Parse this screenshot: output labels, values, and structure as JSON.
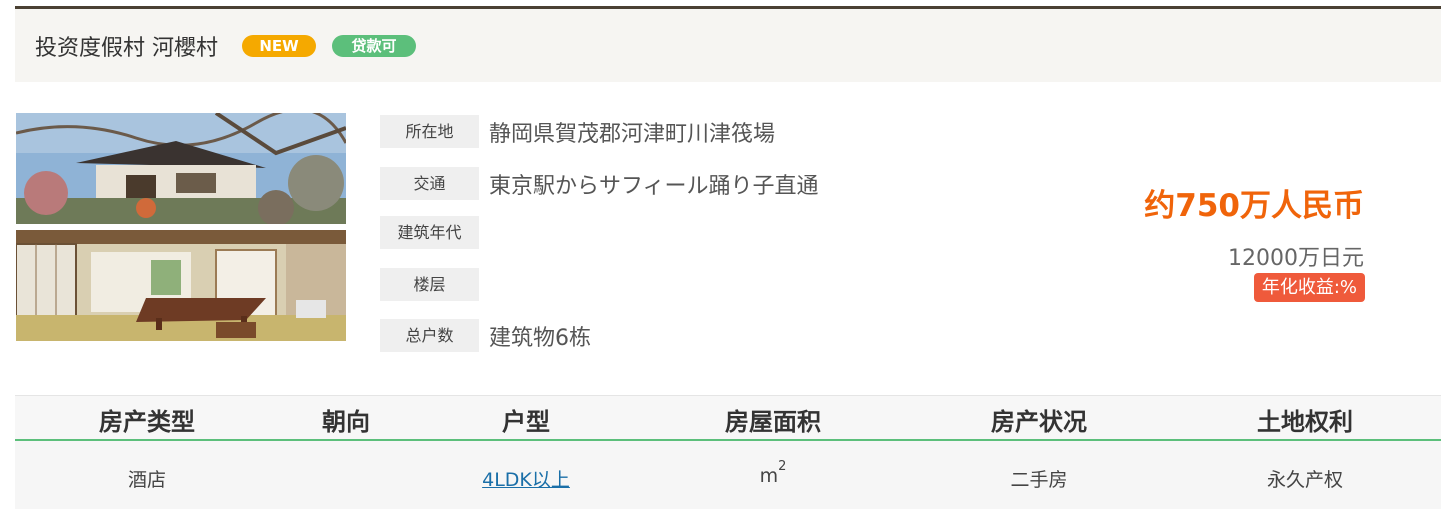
{
  "header": {
    "title": "投资度假村 河櫻村",
    "badge_new": "NEW",
    "badge_loan": "贷款可"
  },
  "info": [
    {
      "label": "所在地",
      "value": "静岡県賀茂郡河津町川津筏場"
    },
    {
      "label": "交通",
      "value": "東京駅からサフィール踊り子直通"
    },
    {
      "label": "建筑年代",
      "value": ""
    },
    {
      "label": "楼层",
      "value": ""
    },
    {
      "label": "总户数",
      "value": "建筑物6栋"
    }
  ],
  "price": {
    "cny": "约750万人民币",
    "jpy": "12000万日元",
    "yield": "年化收益:%"
  },
  "table": {
    "headers": [
      "房产类型",
      "朝向",
      "户型",
      "房屋面积",
      "房产状况",
      "土地权利"
    ],
    "row": {
      "type": "酒店",
      "orientation": "",
      "layout": "4LDK以上",
      "area_unit": "m",
      "area_sup": "2",
      "status": "二手房",
      "land_right": "永久产权"
    }
  },
  "colors": {
    "accent_price": "#f0640a",
    "badge_new": "#f5a900",
    "badge_loan": "#5cbf7b",
    "yield_bg": "#ef5a3b",
    "table_line": "#5cbf7b"
  }
}
